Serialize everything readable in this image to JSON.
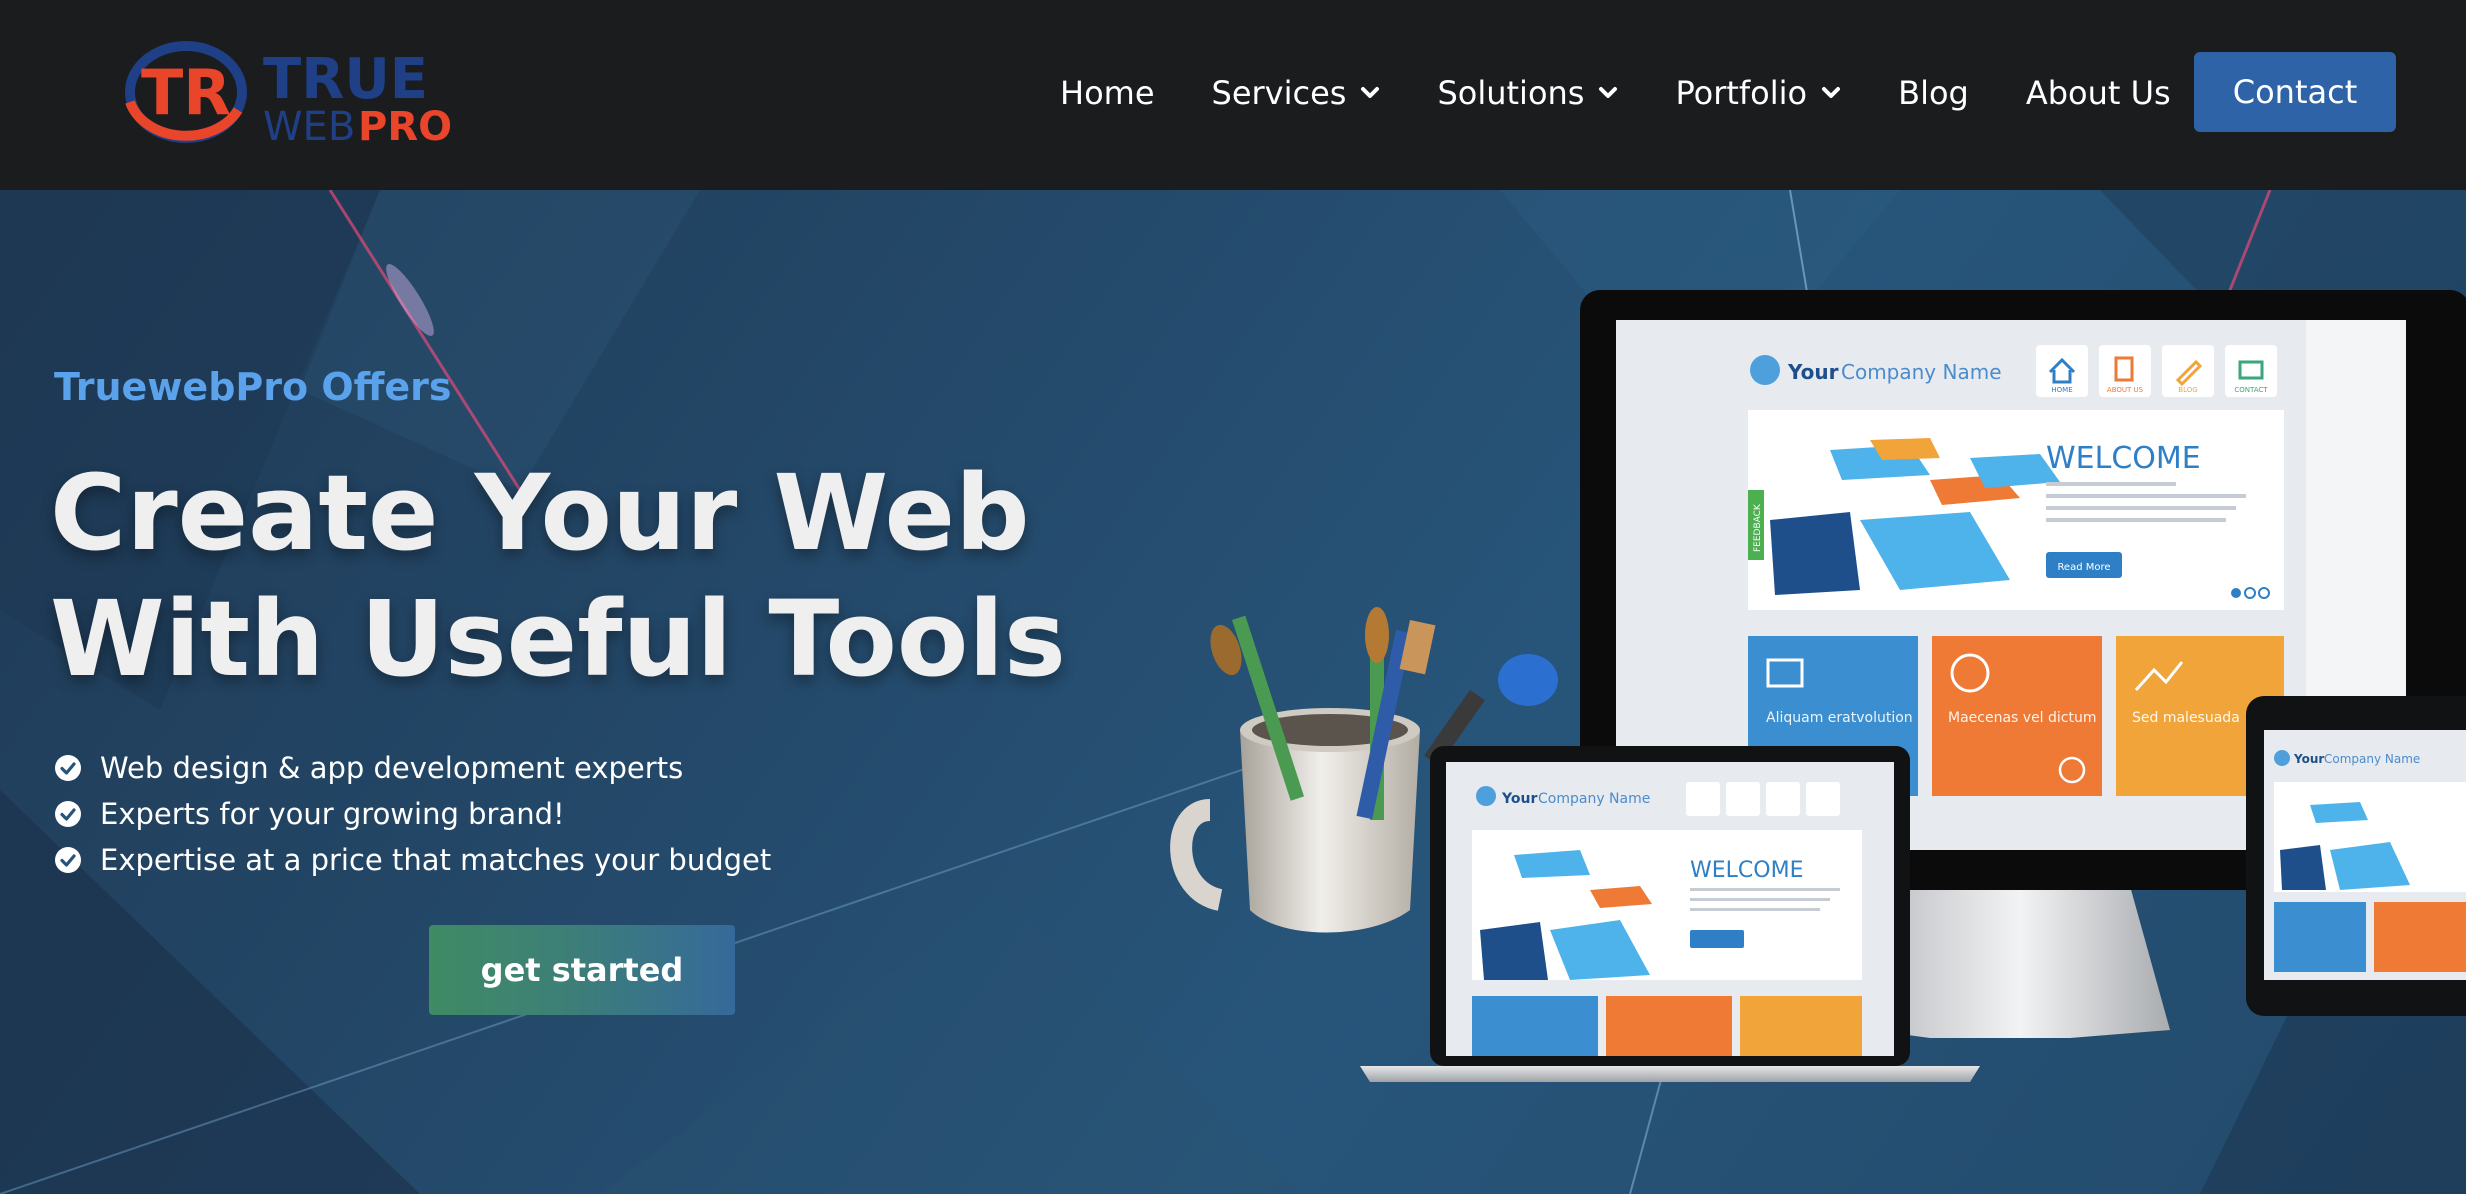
{
  "brand": {
    "logo_mark": "TR",
    "logo_top": "TRUE",
    "logo_bottom_left": "WEB",
    "logo_bottom_right": "PRO",
    "colors": {
      "red": "#e8452a",
      "navy": "#1f3f86"
    }
  },
  "nav": {
    "items": [
      {
        "label": "Home",
        "has_dropdown": false
      },
      {
        "label": "Services",
        "has_dropdown": true
      },
      {
        "label": "Solutions",
        "has_dropdown": true
      },
      {
        "label": "Portfolio",
        "has_dropdown": true
      },
      {
        "label": "Blog",
        "has_dropdown": false
      },
      {
        "label": "About Us",
        "has_dropdown": false
      }
    ],
    "contact_label": "Contact"
  },
  "hero": {
    "eyebrow": "TruewebPro Offers",
    "headline_line1": "Create Your Web",
    "headline_line2": "With Useful Tools",
    "features": [
      "Web design & app development experts",
      "Experts for your growing brand!",
      "Expertise at a price that matches your budget"
    ],
    "cta_label": "get started"
  },
  "mockup": {
    "company_prefix": "Your",
    "company_name": "Company Name",
    "welcome": "WELCOME",
    "read_more": "Read More",
    "feedback": "FEEDBACK",
    "nav_icons": [
      "HOME",
      "ABOUT US",
      "BLOG",
      "CONTACT"
    ],
    "tiles": [
      "Aliquam eratvolution",
      "Maecenas vel dictum",
      "Sed malesuada"
    ]
  },
  "theme": {
    "accent_blue": "#2e63a8",
    "eyebrow_blue": "#5aa3ec",
    "tile_blue": "#3b8fd0",
    "tile_orange": "#ee7a36",
    "tile_yellow": "#f0a43a"
  }
}
